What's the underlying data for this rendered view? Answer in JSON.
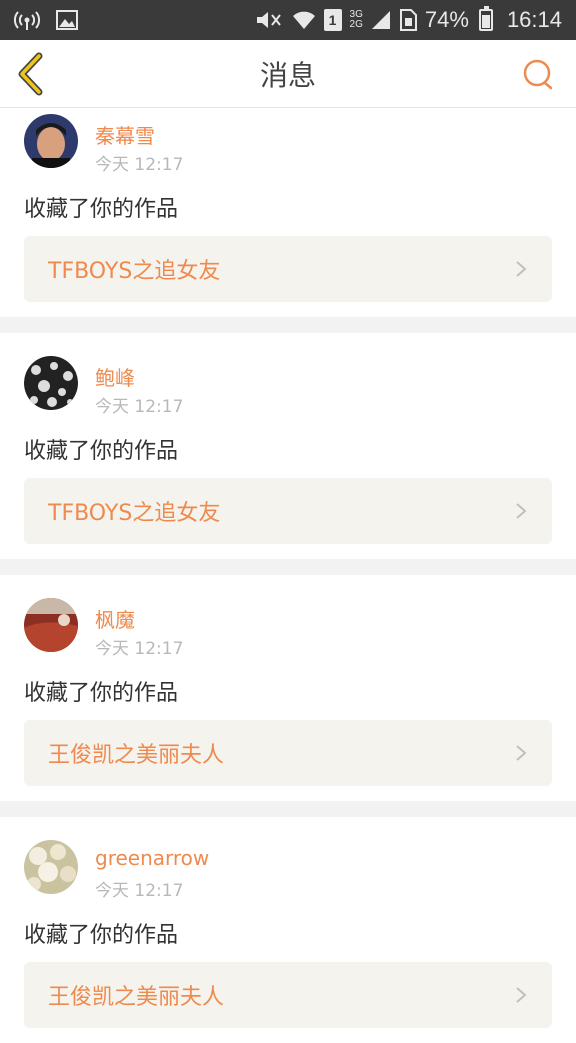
{
  "status_bar": {
    "battery": "74%",
    "battery_level": 0.74,
    "time": "16:14",
    "sim_slot": "1",
    "net_top": "3G",
    "net_bottom": "2G",
    "icons": [
      "wifi-hotspot-icon",
      "image-icon",
      "mute-icon",
      "wifi-icon",
      "signal-icon",
      "sim-icon",
      "battery-icon"
    ]
  },
  "header": {
    "title": "消息",
    "accent": "#ef8a4e",
    "back_color": "#f0c419"
  },
  "messages": [
    {
      "user": "秦幕雪",
      "time": "今天 12:17",
      "action": "收藏了你的作品",
      "work": "TFBOYS之追女友",
      "avatar": "avatar-photo-person"
    },
    {
      "user": "鲍峰",
      "time": "今天 12:17",
      "action": "收藏了你的作品",
      "work": "TFBOYS之追女友",
      "avatar": "avatar-black-white-pattern"
    },
    {
      "user": "枫魔",
      "time": "今天 12:17",
      "action": "收藏了你的作品",
      "work": "王俊凯之美丽夫人",
      "avatar": "avatar-red-scene"
    },
    {
      "user": "greenarrow",
      "time": "今天 12:17",
      "action": "收藏了你的作品",
      "work": "王俊凯之美丽夫人",
      "avatar": "avatar-flowers"
    }
  ]
}
